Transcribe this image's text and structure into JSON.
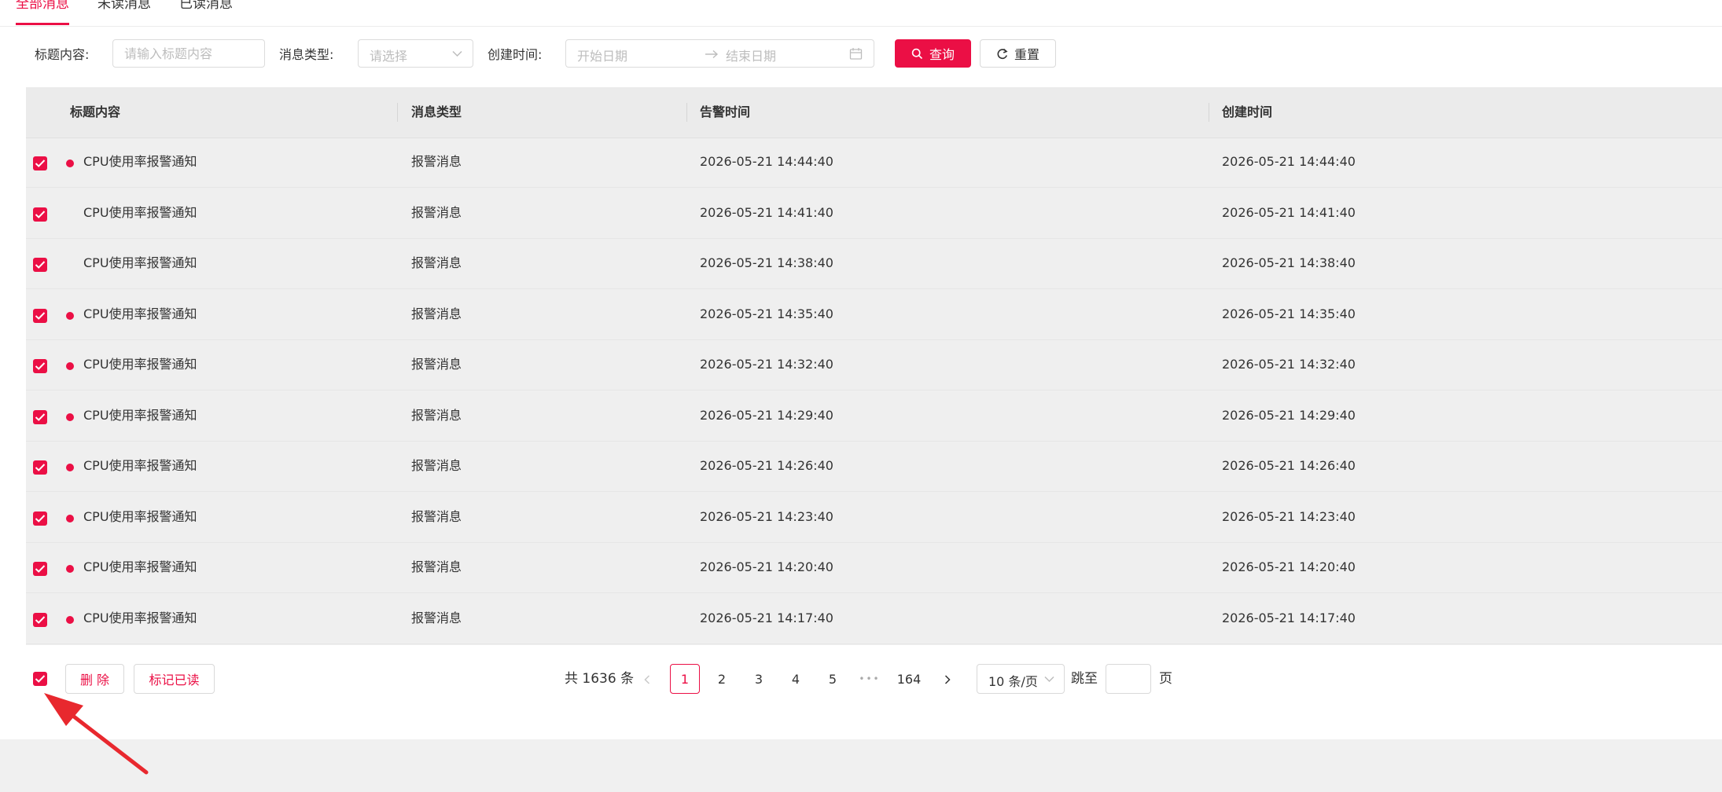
{
  "tabs": [
    {
      "label": "全部消息"
    },
    {
      "label": "未读消息"
    },
    {
      "label": "已读消息"
    }
  ],
  "filters": {
    "title_label": "标题内容:",
    "title_placeholder": "请输入标题内容",
    "type_label": "消息类型:",
    "type_placeholder": "请选择",
    "time_label": "创建时间:",
    "start_placeholder": "开始日期",
    "end_placeholder": "结束日期",
    "query_label": "查询",
    "reset_label": "重置"
  },
  "table": {
    "headers": [
      "标题内容",
      "消息类型",
      "告警时间",
      "创建时间"
    ],
    "rows": [
      {
        "title": "CPU使用率报警通知",
        "type": "报警消息",
        "alarm_time": "2026-05-21 14:44:40",
        "created_time": "2026-05-21 14:44:40",
        "unread": true
      },
      {
        "title": "CPU使用率报警通知",
        "type": "报警消息",
        "alarm_time": "2026-05-21 14:41:40",
        "created_time": "2026-05-21 14:41:40",
        "unread": false
      },
      {
        "title": "CPU使用率报警通知",
        "type": "报警消息",
        "alarm_time": "2026-05-21 14:38:40",
        "created_time": "2026-05-21 14:38:40",
        "unread": false
      },
      {
        "title": "CPU使用率报警通知",
        "type": "报警消息",
        "alarm_time": "2026-05-21 14:35:40",
        "created_time": "2026-05-21 14:35:40",
        "unread": true
      },
      {
        "title": "CPU使用率报警通知",
        "type": "报警消息",
        "alarm_time": "2026-05-21 14:32:40",
        "created_time": "2026-05-21 14:32:40",
        "unread": true
      },
      {
        "title": "CPU使用率报警通知",
        "type": "报警消息",
        "alarm_time": "2026-05-21 14:29:40",
        "created_time": "2026-05-21 14:29:40",
        "unread": true
      },
      {
        "title": "CPU使用率报警通知",
        "type": "报警消息",
        "alarm_time": "2026-05-21 14:26:40",
        "created_time": "2026-05-21 14:26:40",
        "unread": true
      },
      {
        "title": "CPU使用率报警通知",
        "type": "报警消息",
        "alarm_time": "2026-05-21 14:23:40",
        "created_time": "2026-05-21 14:23:40",
        "unread": true
      },
      {
        "title": "CPU使用率报警通知",
        "type": "报警消息",
        "alarm_time": "2026-05-21 14:20:40",
        "created_time": "2026-05-21 14:20:40",
        "unread": true
      },
      {
        "title": "CPU使用率报警通知",
        "type": "报警消息",
        "alarm_time": "2026-05-21 14:17:40",
        "created_time": "2026-05-21 14:17:40",
        "unread": true
      }
    ]
  },
  "footer": {
    "delete_label": "删 除",
    "mark_read_label": "标记已读",
    "total_text": "共 1636 条",
    "pages": [
      "1",
      "2",
      "3",
      "4",
      "5"
    ],
    "ellipsis": "•••",
    "last_page": "164",
    "page_size": "10 条/页",
    "jump_label": "跳至",
    "page_unit": "页"
  },
  "colors": {
    "accent": "#eb0f45",
    "header_bg": "#ebebeb",
    "table_bg": "#efefef",
    "band_bg": "#f0f0f0"
  }
}
